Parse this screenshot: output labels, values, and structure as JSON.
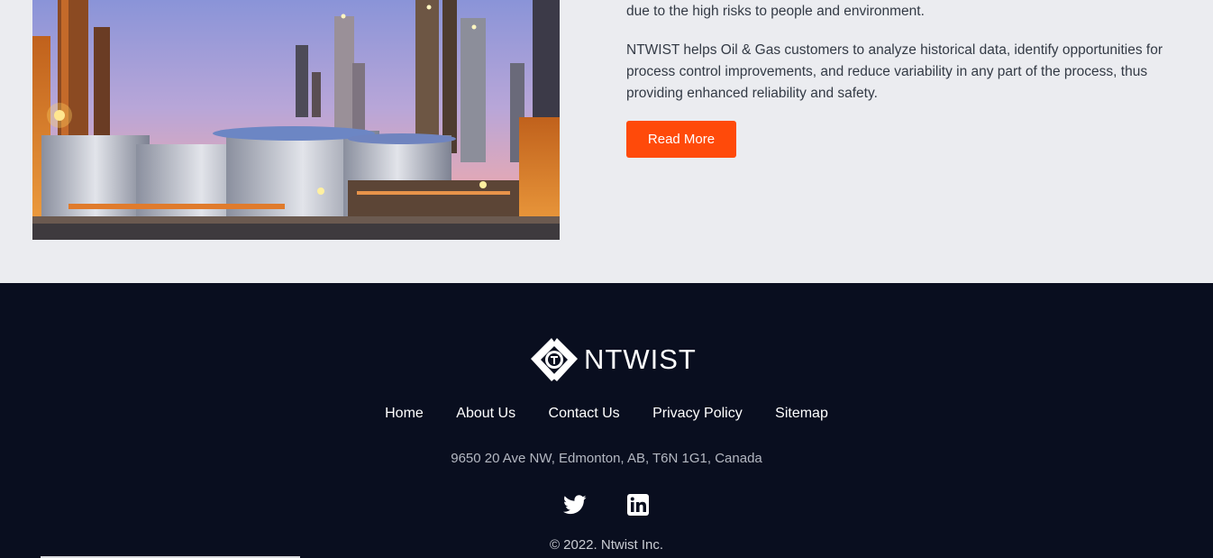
{
  "content": {
    "para1": "due to the high risks to people and environment.",
    "para2": "NTWIST helps Oil & Gas customers to analyze historical data, identify opportunities for process control improvements, and reduce variability in any part of the process, thus providing enhanced reliability and safety.",
    "read_more_label": "Read More"
  },
  "footer": {
    "logo_text": "NTWIST",
    "nav": [
      "Home",
      "About Us",
      "Contact Us",
      "Privacy Policy",
      "Sitemap"
    ],
    "address": "9650 20 Ave NW, Edmonton, AB, T6N 1G1, Canada",
    "social_icons": [
      "twitter-icon",
      "linkedin-icon"
    ],
    "copyright": "© 2022. Ntwist Inc."
  },
  "colors": {
    "accent": "#ff4a0a",
    "footer_bg": "#090e1f",
    "page_bg": "#ebecf0"
  }
}
